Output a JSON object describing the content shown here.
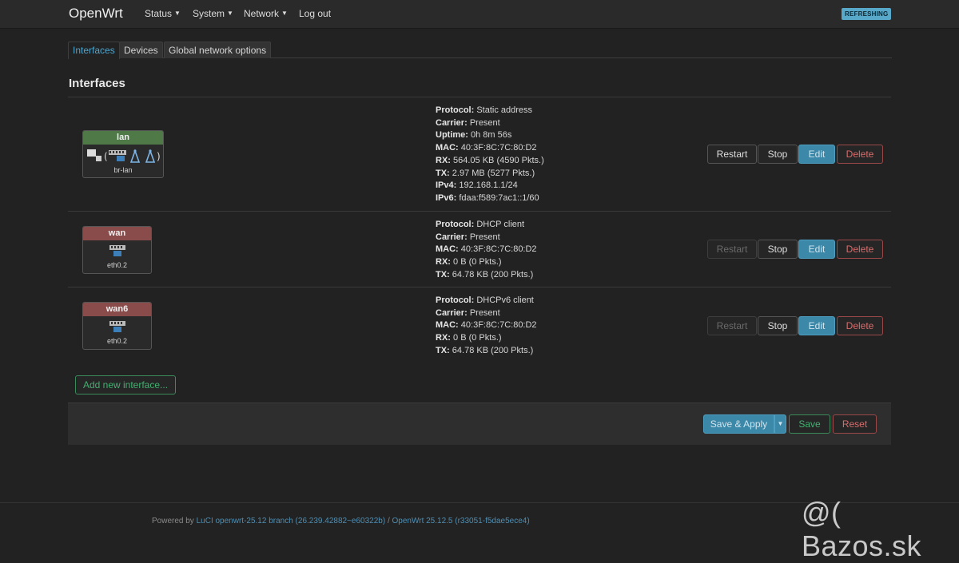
{
  "header": {
    "brand": "OpenWrt",
    "menu": [
      {
        "label": "Status",
        "has_dropdown": true
      },
      {
        "label": "System",
        "has_dropdown": true
      },
      {
        "label": "Network",
        "has_dropdown": true
      },
      {
        "label": "Log out",
        "has_dropdown": false
      }
    ],
    "badge": "REFRESHING"
  },
  "tabs": [
    {
      "label": "Interfaces",
      "active": true
    },
    {
      "label": "Devices",
      "active": false
    },
    {
      "label": "Global network options",
      "active": false
    }
  ],
  "section_title": "Interfaces",
  "interfaces": [
    {
      "name": "lan",
      "device": "br-lan",
      "status": "up",
      "info": [
        {
          "key": "Protocol:",
          "value": "Static address"
        },
        {
          "key": "Carrier:",
          "value": "Present"
        },
        {
          "key": "Uptime:",
          "value": "0h 8m 56s"
        },
        {
          "key": "MAC:",
          "value": "40:3F:8C:7C:80:D2"
        },
        {
          "key": "RX:",
          "value": "564.05 KB (4590 Pkts.)"
        },
        {
          "key": "TX:",
          "value": "2.97 MB (5277 Pkts.)"
        },
        {
          "key": "IPv4:",
          "value": "192.168.1.1/24"
        },
        {
          "key": "IPv6:",
          "value": "fdaa:f589:7ac1::1/60"
        }
      ],
      "restart_enabled": true
    },
    {
      "name": "wan",
      "device": "eth0.2",
      "status": "down",
      "info": [
        {
          "key": "Protocol:",
          "value": "DHCP client"
        },
        {
          "key": "Carrier:",
          "value": "Present"
        },
        {
          "key": "MAC:",
          "value": "40:3F:8C:7C:80:D2"
        },
        {
          "key": "RX:",
          "value": "0 B (0 Pkts.)"
        },
        {
          "key": "TX:",
          "value": "64.78 KB (200 Pkts.)"
        }
      ],
      "restart_enabled": false
    },
    {
      "name": "wan6",
      "device": "eth0.2",
      "status": "down",
      "info": [
        {
          "key": "Protocol:",
          "value": "DHCPv6 client"
        },
        {
          "key": "Carrier:",
          "value": "Present"
        },
        {
          "key": "MAC:",
          "value": "40:3F:8C:7C:80:D2"
        },
        {
          "key": "RX:",
          "value": "0 B (0 Pkts.)"
        },
        {
          "key": "TX:",
          "value": "64.78 KB (200 Pkts.)"
        }
      ],
      "restart_enabled": false
    }
  ],
  "row_buttons": {
    "restart": "Restart",
    "stop": "Stop",
    "edit": "Edit",
    "delete": "Delete"
  },
  "add_interface_label": "Add new interface...",
  "actions": {
    "save_apply": "Save & Apply",
    "save": "Save",
    "reset": "Reset"
  },
  "footer": {
    "prefix": "Powered by ",
    "luci": "LuCI openwrt-25.12 branch (26.239.42882~e60322b)",
    "sep": " / ",
    "openwrt": "OpenWrt 25.12.5 (r33051-f5dae5ece4)"
  },
  "watermark": "@( Bazos.sk",
  "colors": {
    "accent": "#4fa4cc",
    "lan_header": "#4f7a48",
    "wan_header": "#8a4b4b",
    "danger": "#d76d6d",
    "success": "#42b070"
  }
}
